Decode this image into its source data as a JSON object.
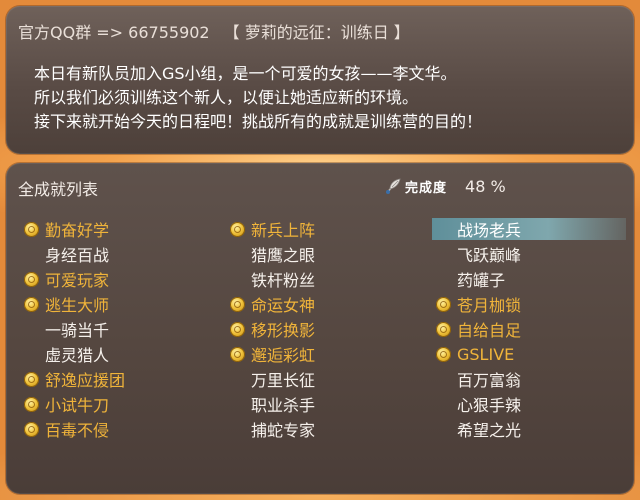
{
  "header": {
    "group_label": "官方QQ群 => 66755902",
    "chapter_title": "【 萝莉的远征：训练日 】"
  },
  "description": [
    "本日有新队员加入GS小组，是一个可爱的女孩——李文华。",
    "所以我们必须训练这个新人，以便让她适应新的环境。",
    "接下来就开始今天的日程吧！挑战所有的成就是训练营的目的！"
  ],
  "achievement_list": {
    "title": "全成就列表",
    "progress_label": "完成度",
    "progress_value": "48 %",
    "progress_fraction": 0.48,
    "columns": [
      [
        {
          "label": "勤奋好学",
          "done": true
        },
        {
          "label": "身经百战",
          "done": false
        },
        {
          "label": "可爱玩家",
          "done": true
        },
        {
          "label": "逃生大师",
          "done": true
        },
        {
          "label": "一骑当千",
          "done": false
        },
        {
          "label": "虚灵猎人",
          "done": false
        },
        {
          "label": "舒逸应援团",
          "done": true
        },
        {
          "label": "小试牛刀",
          "done": true
        },
        {
          "label": "百毒不侵",
          "done": true
        }
      ],
      [
        {
          "label": "新兵上阵",
          "done": true
        },
        {
          "label": "猎鹰之眼",
          "done": false
        },
        {
          "label": "铁杆粉丝",
          "done": false
        },
        {
          "label": "命运女神",
          "done": true
        },
        {
          "label": "移形换影",
          "done": true
        },
        {
          "label": "邂逅彩虹",
          "done": true
        },
        {
          "label": "万里长征",
          "done": false
        },
        {
          "label": "职业杀手",
          "done": false
        },
        {
          "label": "捕蛇专家",
          "done": false
        }
      ],
      [
        {
          "label": "战场老兵",
          "done": false,
          "selected": true
        },
        {
          "label": "飞跃巅峰",
          "done": false
        },
        {
          "label": "药罐子",
          "done": false
        },
        {
          "label": "苍月枷锁",
          "done": true
        },
        {
          "label": "自给自足",
          "done": true
        },
        {
          "label": "GSLIVE",
          "done": true
        },
        {
          "label": "百万富翁",
          "done": false
        },
        {
          "label": "心狠手辣",
          "done": false
        },
        {
          "label": "希望之光",
          "done": false
        }
      ]
    ]
  },
  "colors": {
    "done_text": "#f0b43a",
    "todo_text": "#f6f1ec",
    "selected_highlight": "#7fa7ad",
    "background": "#e38a3a"
  },
  "icons": {
    "done_marker": "gold-coin-icon",
    "progress": "feather-quill-icon"
  }
}
